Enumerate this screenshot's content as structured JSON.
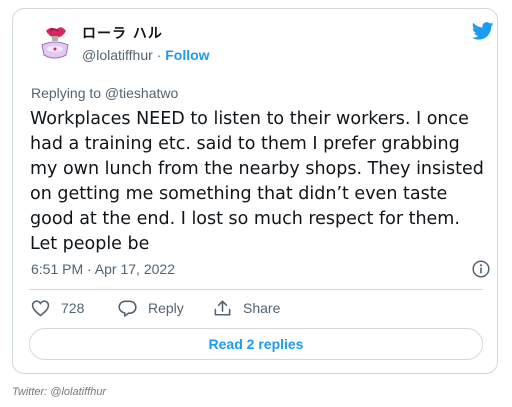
{
  "tweet": {
    "author_name": "ローラ ハル",
    "handle": "@lolatiffhur",
    "separator": " · ",
    "follow_label": "Follow",
    "replying_to": "Replying to @tieshatwo",
    "text": "Workplaces NEED to listen to their workers. I once had a training etc. said to them I prefer grabbing my own lunch from the nearby shops. They insisted on getting me something that didn’t even taste good at the end. I lost so much respect for them. Let people be",
    "timestamp": "6:51 PM · Apr 17, 2022",
    "likes": "728",
    "reply_label": "Reply",
    "share_label": "Share",
    "read_replies_label": "Read 2 replies"
  },
  "icons": {
    "brand": "twitter-bird-icon",
    "info": "info-icon",
    "like": "heart-icon",
    "reply": "reply-bubble-icon",
    "share": "share-icon"
  },
  "colors": {
    "accent": "#1d9bf0",
    "text": "#0f1419",
    "muted": "#536471",
    "border": "#cfd9de"
  },
  "credit": "Twitter: @lolatiffhur"
}
